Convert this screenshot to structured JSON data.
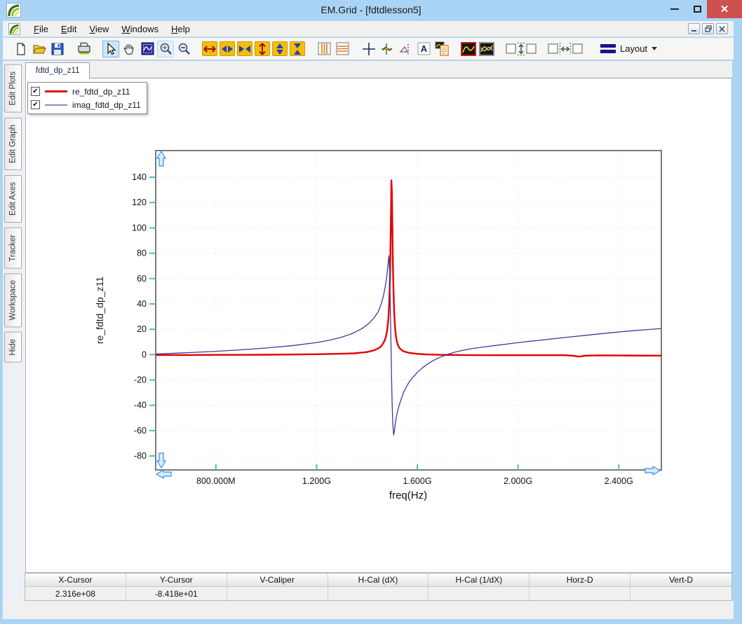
{
  "window": {
    "title": "EM.Grid - [fdtdlesson5]",
    "controls": {
      "minimize": "minimize",
      "maximize": "maximize",
      "close": "close"
    }
  },
  "menu": {
    "items": [
      {
        "label": "File"
      },
      {
        "label": "Edit"
      },
      {
        "label": "View"
      },
      {
        "label": "Windows"
      },
      {
        "label": "Help"
      }
    ]
  },
  "toolbar": {
    "layout_label": "Layout",
    "text_tool_glyph": "A"
  },
  "sidebar": {
    "tabs": [
      "Edit Plots",
      "Edit Graph",
      "Edit Axes",
      "Tracker",
      "Workspace",
      "Hide"
    ]
  },
  "doc": {
    "tab_label": "fdtd_dp_z11"
  },
  "legend": {
    "items": [
      {
        "label": "re_fdtd_dp_z11",
        "checked": true,
        "sample_color": "#dd1111",
        "sample_weight": 3
      },
      {
        "label": "imag_fdtd_dp_z11",
        "checked": true,
        "sample_color": "#8a8ac4",
        "sample_weight": 2
      }
    ]
  },
  "chart_data": {
    "type": "line",
    "xlabel": "freq(Hz)",
    "ylabel": "re_fdtd_dp_z11",
    "x_unit": "GHz",
    "xlim": [
      0.561,
      2.569
    ],
    "ylim": [
      -91,
      161
    ],
    "x_ticks": [
      0.8,
      1.2,
      1.6,
      2.0,
      2.4
    ],
    "x_tick_labels": [
      "800.000M",
      "1.200G",
      "1.600G",
      "2.000G",
      "2.400G"
    ],
    "y_ticks": [
      -80,
      -60,
      -40,
      -20,
      0,
      20,
      40,
      60,
      80,
      100,
      120,
      140
    ],
    "grid": true,
    "legend_position": "top-left",
    "series": [
      {
        "name": "re_fdtd_dp_z11",
        "color": "#e40000",
        "width": 2.4,
        "points": [
          [
            0.561,
            -0.3
          ],
          [
            0.7,
            -0.3
          ],
          [
            0.8,
            -0.2
          ],
          [
            0.9,
            -0.2
          ],
          [
            1.0,
            -0.1
          ],
          [
            1.1,
            0.1
          ],
          [
            1.2,
            0.3
          ],
          [
            1.3,
            0.7
          ],
          [
            1.35,
            1.0
          ],
          [
            1.4,
            2.0
          ],
          [
            1.43,
            3.5
          ],
          [
            1.45,
            5.5
          ],
          [
            1.46,
            7.5
          ],
          [
            1.47,
            11
          ],
          [
            1.475,
            14
          ],
          [
            1.48,
            19
          ],
          [
            1.485,
            28
          ],
          [
            1.488,
            40
          ],
          [
            1.491,
            58
          ],
          [
            1.493,
            78
          ],
          [
            1.495,
            108
          ],
          [
            1.497,
            137.5
          ],
          [
            1.499,
            128
          ],
          [
            1.501,
            100
          ],
          [
            1.503,
            72
          ],
          [
            1.505,
            52
          ],
          [
            1.508,
            34
          ],
          [
            1.511,
            23
          ],
          [
            1.514,
            16
          ],
          [
            1.518,
            11
          ],
          [
            1.523,
            7.5
          ],
          [
            1.53,
            5
          ],
          [
            1.54,
            3.2
          ],
          [
            1.55,
            2.3
          ],
          [
            1.57,
            1.3
          ],
          [
            1.6,
            0.6
          ],
          [
            1.63,
            0.2
          ],
          [
            1.66,
            0.0
          ],
          [
            1.7,
            -0.2
          ],
          [
            1.8,
            -0.4
          ],
          [
            1.9,
            -0.5
          ],
          [
            2.0,
            -0.5
          ],
          [
            2.1,
            -0.5
          ],
          [
            2.18,
            -0.4
          ],
          [
            2.22,
            -1.0
          ],
          [
            2.24,
            -1.6
          ],
          [
            2.27,
            -0.8
          ],
          [
            2.32,
            -0.6
          ],
          [
            2.4,
            -0.7
          ],
          [
            2.5,
            -0.8
          ],
          [
            2.569,
            -0.8
          ]
        ]
      },
      {
        "name": "imag_fdtd_dp_z11",
        "color": "#3c3c99",
        "width": 1.3,
        "points": [
          [
            0.561,
            0.5
          ],
          [
            0.65,
            1.2
          ],
          [
            0.7,
            1.6
          ],
          [
            0.8,
            2.6
          ],
          [
            0.9,
            3.8
          ],
          [
            1.0,
            5.2
          ],
          [
            1.1,
            7.0
          ],
          [
            1.2,
            9.5
          ],
          [
            1.25,
            11.3
          ],
          [
            1.3,
            13.8
          ],
          [
            1.34,
            16.5
          ],
          [
            1.38,
            20.5
          ],
          [
            1.41,
            25
          ],
          [
            1.43,
            29.5
          ],
          [
            1.445,
            34
          ],
          [
            1.455,
            39
          ],
          [
            1.465,
            46
          ],
          [
            1.472,
            53
          ],
          [
            1.478,
            61
          ],
          [
            1.483,
            70
          ],
          [
            1.487,
            78
          ],
          [
            1.49,
            65
          ],
          [
            1.4925,
            40
          ],
          [
            1.495,
            12
          ],
          [
            1.4975,
            -18
          ],
          [
            1.5,
            -40
          ],
          [
            1.503,
            -55
          ],
          [
            1.506,
            -63.5
          ],
          [
            1.509,
            -60
          ],
          [
            1.512,
            -55
          ],
          [
            1.516,
            -50
          ],
          [
            1.521,
            -45
          ],
          [
            1.528,
            -40
          ],
          [
            1.536,
            -35
          ],
          [
            1.545,
            -30
          ],
          [
            1.556,
            -25.5
          ],
          [
            1.568,
            -21.5
          ],
          [
            1.582,
            -18
          ],
          [
            1.6,
            -14
          ],
          [
            1.62,
            -10.5
          ],
          [
            1.64,
            -7.5
          ],
          [
            1.66,
            -5
          ],
          [
            1.68,
            -3
          ],
          [
            1.7,
            -1.3
          ],
          [
            1.72,
            0.2
          ],
          [
            1.75,
            2.0
          ],
          [
            1.78,
            3.4
          ],
          [
            1.82,
            4.8
          ],
          [
            1.87,
            6.2
          ],
          [
            1.92,
            7.5
          ],
          [
            1.97,
            8.7
          ],
          [
            2.02,
            9.9
          ],
          [
            2.08,
            11.2
          ],
          [
            2.14,
            12.5
          ],
          [
            2.2,
            13.8
          ],
          [
            2.26,
            15.0
          ],
          [
            2.32,
            16.3
          ],
          [
            2.38,
            17.5
          ],
          [
            2.44,
            18.6
          ],
          [
            2.5,
            19.5
          ],
          [
            2.569,
            20.6
          ]
        ]
      }
    ]
  },
  "statusbar": {
    "columns": [
      {
        "label": "X-Cursor",
        "value": "2.316e+08"
      },
      {
        "label": "Y-Cursor",
        "value": "-8.418e+01"
      },
      {
        "label": "V-Caliper",
        "value": ""
      },
      {
        "label": "H-Cal (dX)",
        "value": ""
      },
      {
        "label": "H-Cal (1/dX)",
        "value": ""
      },
      {
        "label": "Horz-D",
        "value": ""
      },
      {
        "label": "Vert-D",
        "value": ""
      }
    ]
  },
  "colors": {
    "titlebar": "#a9d4f5",
    "close_button": "#cf5050",
    "re_curve": "#e40000",
    "imag_curve": "#3c3c99",
    "tool_yellow": "#f5bd0a",
    "axis_frame": "#7a7a7a",
    "axis_ticks": "#5eb2c6"
  }
}
